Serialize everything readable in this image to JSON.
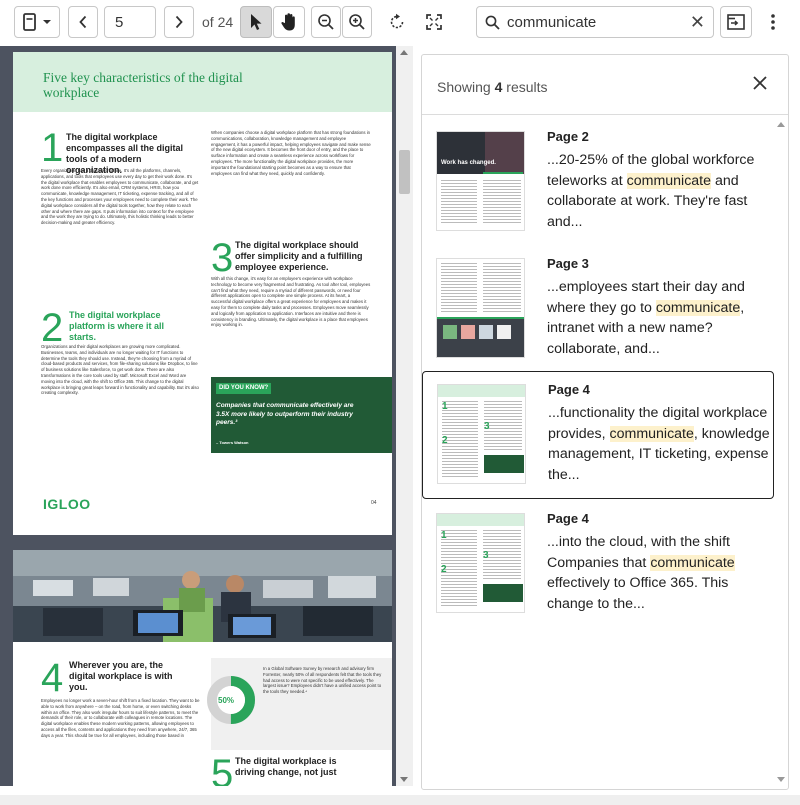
{
  "toolbar": {
    "current_page": "5",
    "page_of": "of 24",
    "search_value": "communicate"
  },
  "page_a": {
    "title": "Five key characteristics of the digital workplace",
    "s1_num": "1",
    "s1_title": "The digital workplace encompasses all the digital tools of a modern organization.",
    "s1_body": "Every organization has a digital workplace. It's all the platforms, channels, applications, and tools that employees use every day to get their work done. It's the digital workplace that enables employees to communicate, collaborate, and get work done more efficiently. It's also email, CRM systems, HRIS, how you communicate, knowledge management, IT ticketing, expense tracking, and all of the key functions and processes your employees need to complete their work. The digital workplace considers all the digital tools together, how they relate to each other and where there are gaps. It puts information into context for the employee and the work they are trying to do. Ultimately, this holistic thinking leads to better decision-making and greater efficiency.",
    "s2_num": "2",
    "s2_title": "The digital workplace platform is where it all starts.",
    "s2_body": "Organizations and their digital workplaces are growing more complicated. Businesses, teams, and individuals are no longer waiting for IT functions to determine the tools they should use. Instead, they're choosing from a myriad of cloud-based products and services, from file-sharing solutions like Dropbox, to line of business solutions like Salesforce, to get work done. There are also transformations in the core tools used by staff. Microsoft Excel and Word are moving into the cloud, with the shift to Office 365. This change to the digital workplace is bringing great leaps forward in functionality and capability. But it's also creating complexity.",
    "colr_body": "When companies choose a digital workplace platform that has strong foundations in communications, collaboration, knowledge management and employee engagement, it has a powerful impact, helping employees navigate and make sense of the new digital ecosystem. It becomes the front door of entry, and the place to surface information and create a seamless experience across workflows for employees. The more functionality the digital workplace provides, the more important the foundational starting point becomes as a way to ensure that employees can find what they need, quickly and confidently.",
    "s3_num": "3",
    "s3_title": "The digital workplace should offer simplicity and a fulfilling employee experience.",
    "s3_body": "With all this change, it's easy for an employee's experience with workplace technology to become very fragmented and frustrating. As tool after tool, employees can't find what they need, require a myriad of different passwords, or need four different applications open to complete one simple process. At its heart, a successful digital workplace offers a great experience for employees and makes it easy for them to complete daily tasks and processes. Employees move seamlessly and logically from application to application. Interfaces are intuitive and there is consistency in branding. Ultimately, the digital workplace is a place that employees enjoy working in.",
    "dyk_tag": "DID YOU KNOW?",
    "dyk_quote": "Companies that communicate effectively are 3.5X more likely to outperform their industry peers.³",
    "dyk_source": "– Towers Watson",
    "logo": "IGLOO",
    "page_number": "04"
  },
  "page_b": {
    "s4_num": "4",
    "s4_title": "Wherever you are, the digital workplace is with you.",
    "s4_body": "Employees no longer work a seven-hour shift from a fixed location. They want to be able to work from anywhere – on the road, from home, or even switching desks within an office. They also work irregular hours to suit lifestyle patterns, to meet the demands of their role, or to collaborate with colleagues in remote locations. The digital workplace enables these modern working patterns, allowing employees to access all the files, contents and applications they need from anywhere, 24/7, 365 days a year. This should be true for all employees, including those based in",
    "stat_value": "50%",
    "stat_body": "In a Global Software Survey by research and advisory firm Forrester, nearly 50% of all respondents felt that the tools they had access to were not specific to be used effectively. The largest issue? Employees didn't have a unified access point to the tools they needed.⁴",
    "s5_num": "5",
    "s5_title": "The digital workplace is driving change, not just"
  },
  "results": {
    "count": "4",
    "showing_prefix": "Showing ",
    "showing_suffix": " results",
    "items": [
      {
        "page": "Page 2",
        "before": "...20-25% of the global workforce teleworks at ",
        "match": "communicate",
        "after": " and collaborate at work. They're fast and...",
        "thumb_banner": "Work has changed."
      },
      {
        "page": "Page 3",
        "before": "...employees start their day and where they go to ",
        "match": "communicate",
        "after": ", intranet with a new name? collaborate, and..."
      },
      {
        "page": "Page 4",
        "before": "...functionality the digital workplace provides, ",
        "match": "communicate",
        "after": ", knowledge management, IT ticketing, expense the..."
      },
      {
        "page": "Page 4",
        "before": "...into the cloud, with the shift Companies that ",
        "match": "communicate",
        "after": " effectively to Office 365. This change to the..."
      }
    ]
  },
  "colors": {
    "brand_green": "#2aa45a",
    "dark_green": "#215a36",
    "header_mint": "#d7efde",
    "highlight": "#fdf1cc",
    "viewer_bg": "#4d5360"
  }
}
